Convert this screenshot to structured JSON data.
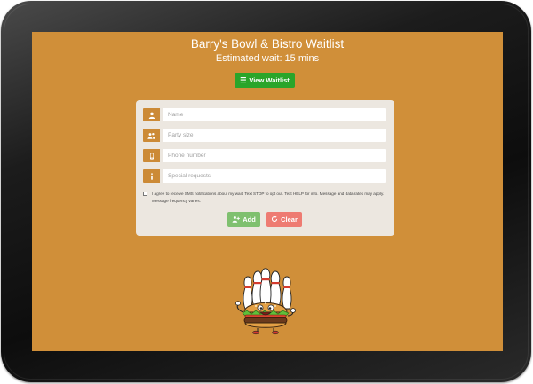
{
  "header": {
    "title": "Barry's Bowl & Bistro Waitlist",
    "wait_text": "Estimated wait: 15 mins"
  },
  "view_waitlist_button": {
    "label": "View Waitlist",
    "icon": "list-icon"
  },
  "form": {
    "name": {
      "placeholder": "Name",
      "icon": "user-icon"
    },
    "party_size": {
      "placeholder": "Party size",
      "icon": "users-icon"
    },
    "phone": {
      "placeholder": "Phone number",
      "icon": "phone-icon"
    },
    "special_requests": {
      "placeholder": "Special requests",
      "icon": "info-icon"
    },
    "consent_text": "I agree to receive SMS notifications about my wait. Text STOP to opt out. Text HELP for info. Message and data rates may apply. Message frequency varies.",
    "consent_checked": false,
    "add_label": "Add",
    "clear_label": "Clear"
  },
  "colors": {
    "screen_bg": "#d08f39",
    "view_button": "#2aa52a",
    "add_button": "#7fc06f",
    "clear_button": "#ee7b72",
    "panel_bg": "#ece7e0",
    "addon_bg": "#cc8a36"
  },
  "mascot": {
    "icon": "bowling-pins-burger-mascot-icon"
  }
}
